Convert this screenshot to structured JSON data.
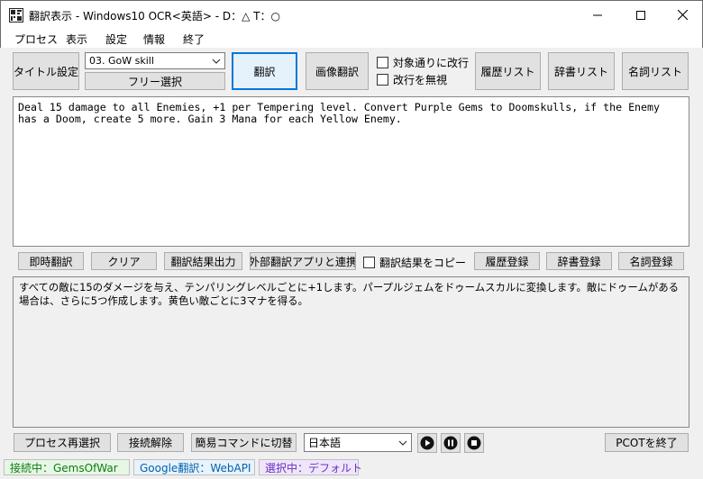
{
  "window": {
    "title": "翻訳表示 - Windows10 OCR<英語> - D：△ T：○"
  },
  "menu": [
    "プロセス",
    "表示",
    "設定",
    "情報",
    "終了"
  ],
  "toolbar": {
    "title_settings": "タイトル設定",
    "profile_combo": "03. GoW skill",
    "free_select": "フリー選択",
    "translate": "翻訳",
    "image_translate": "画像翻訳",
    "newline_by_target": "対象通りに改行",
    "ignore_newline": "改行を無視",
    "history_list": "履歴リスト",
    "dictionary_list": "辞書リスト",
    "noun_list": "名詞リスト"
  },
  "source_text": "Deal 15 damage to all Enemies, +1 per Tempering level. Convert Purple Gems to Doomskulls, if the Enemy has a Doom, create 5 more. Gain 3 Mana for each Yellow Enemy.",
  "actions": {
    "instant_translate": "即時翻訳",
    "clear": "クリア",
    "output_result": "翻訳結果出力",
    "external_app": "外部翻訳アプリと連携",
    "copy_result": "翻訳結果をコピー",
    "register_history": "履歴登録",
    "register_dictionary": "辞書登録",
    "register_noun": "名詞登録"
  },
  "translated_text": "すべての敵に15のダメージを与え、テンパリングレベルごとに+1します。パープルジェムをドゥームスカルに変換します。敵にドゥームがある場合は、さらに5つ作成します。黄色い敵ごとに3マナを得る。",
  "bottom": {
    "reselect_process": "プロセス再選択",
    "disconnect": "接続解除",
    "switch_simple_command": "簡易コマンドに切替",
    "language": "日本語",
    "exit_pcot": "PCOTを終了"
  },
  "status": {
    "connected": "接続中：GemsOfWar",
    "engine": "Google翻訳：WebAPI",
    "selected": "選択中：デフォルト"
  }
}
